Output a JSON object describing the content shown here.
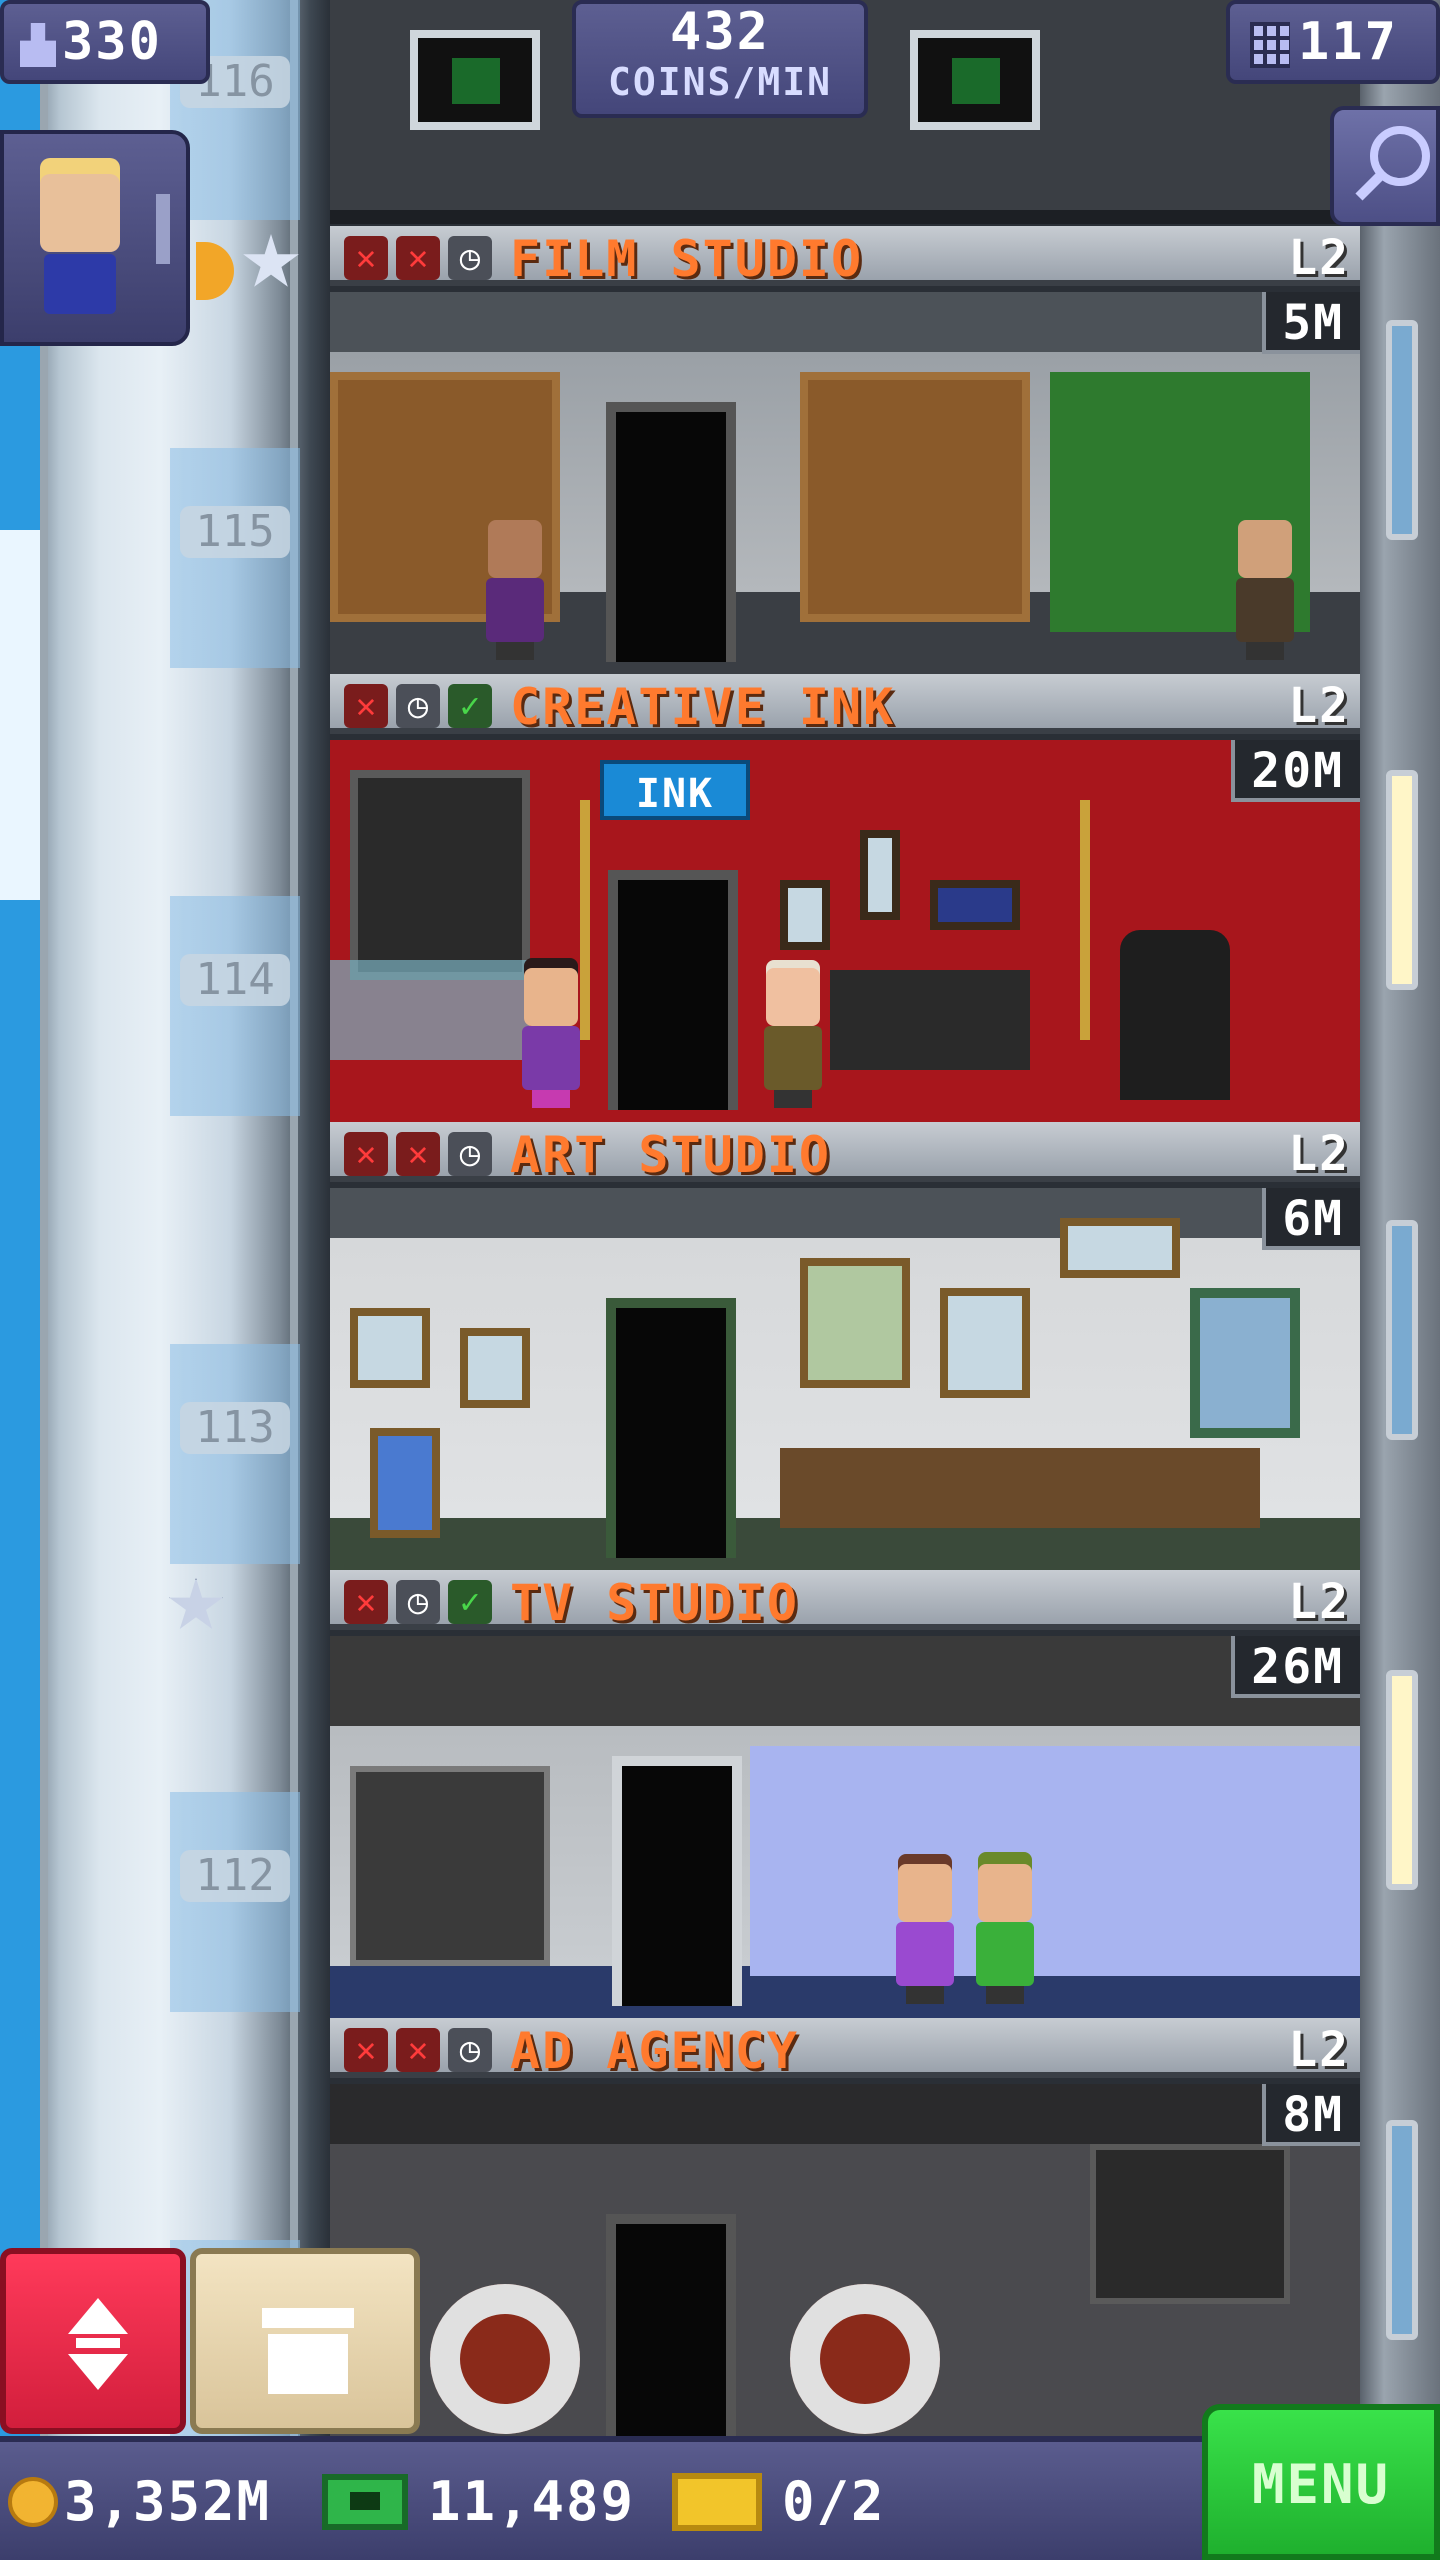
{
  "hud": {
    "population": "330",
    "coins_per_min_value": "432",
    "coins_per_min_label": "COINS/MIN",
    "floors": "117"
  },
  "shaft": {
    "floor_numbers": [
      "116",
      "115",
      "114",
      "113",
      "112"
    ]
  },
  "floors": [
    {
      "name": "FILM STUDIO",
      "level": "L2",
      "stock": "5M",
      "status": [
        "x",
        "x",
        "clock"
      ]
    },
    {
      "name": "CREATIVE INK",
      "level": "L2",
      "stock": "20M",
      "status": [
        "x",
        "clock",
        "check"
      ],
      "sign": "INK"
    },
    {
      "name": "ART STUDIO",
      "level": "L2",
      "stock": "6M",
      "status": [
        "x",
        "x",
        "clock"
      ]
    },
    {
      "name": "TV STUDIO",
      "level": "L2",
      "stock": "26M",
      "status": [
        "x",
        "clock",
        "check"
      ]
    },
    {
      "name": "AD AGENCY",
      "level": "L2",
      "stock": "8M",
      "status": [
        "x",
        "x",
        "clock"
      ]
    }
  ],
  "bottom_bar": {
    "coins": "3,352M",
    "tower_bux": "11,489",
    "tickets": "0/2",
    "menu_label": "MENU"
  },
  "icons": {
    "population": "person-icon",
    "floors": "building-grid-icon",
    "search": "magnifier-icon",
    "elevator": "up-down-arrows-icon",
    "build": "box-icon",
    "coins": "coin-icon",
    "bux": "tower-bux-icon",
    "tickets": "ticket-icon"
  },
  "colors": {
    "floor_name": "#ff7a2e",
    "hud_bg": "#4f5186",
    "menu_green": "#2ecc40",
    "elevator_red": "#e8264a"
  }
}
